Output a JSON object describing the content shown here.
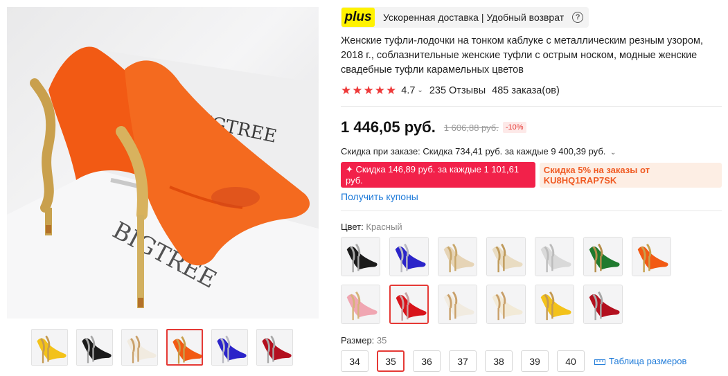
{
  "plus": {
    "logo": "plus",
    "text": "Ускоренная доставка | Удобный возврат",
    "help_icon": "question-circle-icon"
  },
  "product": {
    "title": "Женские туфли-лодочки на тонком каблуке с металлическим резным узором, 2018 г., соблазнительные женские туфли с острым носком, модные женские свадебные туфли карамельных цветов",
    "rating": "4.7",
    "reviews": "235 Отзывы",
    "orders": "485 заказа(ов)"
  },
  "price": {
    "current": "1 446,05 руб.",
    "old": "1 606,88 руб.",
    "discount": "-10%"
  },
  "promo": {
    "order_discount": "Скидка при заказе: Скидка 734,41 руб. за каждые 9 400,39 руб.",
    "coupon_red": "✦ Скидка 146,89 руб. за каждые 1 101,61 руб.",
    "coupon_code": "Скидка 5% на заказы от KU8HQ1RAP7SK",
    "get_coupons": "Получить купоны"
  },
  "color": {
    "label": "Цвет:",
    "selected": "Красный",
    "swatches": [
      {
        "color": "#1b1b1b",
        "heel": "#a8a8a8"
      },
      {
        "color": "#2b24c9",
        "heel": "#b9b9c2"
      },
      {
        "color": "#e6d4b6",
        "heel": "#c9a86c"
      },
      {
        "color": "#e9dcc2",
        "heel": "#bf9a5a"
      },
      {
        "color": "#d9d9d9",
        "heel": "#bcbcbc"
      },
      {
        "color": "#1f7a2e",
        "heel": "#b58d4a"
      },
      {
        "color": "#f25a14",
        "heel": "#c7a04d"
      },
      {
        "color": "#f0a6b2",
        "heel": "#d6b37a"
      },
      {
        "color": "#d8141b",
        "heel": "#c9a0a0"
      },
      {
        "color": "#f1ebe0",
        "heel": "#c9a06a"
      },
      {
        "color": "#f2ead7",
        "heel": "#c9a06a"
      },
      {
        "color": "#f3c21a",
        "heel": "#c49a52"
      },
      {
        "color": "#b3101f",
        "heel": "#a8a8a8"
      }
    ],
    "selected_index": 8
  },
  "size": {
    "label": "Размер:",
    "selected": "35",
    "options": [
      "34",
      "35",
      "36",
      "37",
      "38",
      "39",
      "40"
    ],
    "table_label": "Таблица размеров",
    "table_icon": "ruler-icon"
  },
  "gallery": {
    "main_color": "#f25a14",
    "brand_text": "BIGTREE",
    "thumbs": [
      {
        "color": "#f3c21a",
        "heel": "#c49a52"
      },
      {
        "color": "#1b1b1b",
        "heel": "#a8a8a8"
      },
      {
        "color": "#f1ebe0",
        "heel": "#c9a06a"
      },
      {
        "color": "#f25a14",
        "heel": "#c7a04d"
      },
      {
        "color": "#2b24c9",
        "heel": "#b9b9c2"
      },
      {
        "color": "#b3101f",
        "heel": "#a8a8a8"
      }
    ],
    "active_thumb": 3
  },
  "colors": {
    "accent_red": "#e53935",
    "link_blue": "#1f7bd9",
    "star": "#ee3a3a",
    "plus_yellow": "#fff200"
  }
}
